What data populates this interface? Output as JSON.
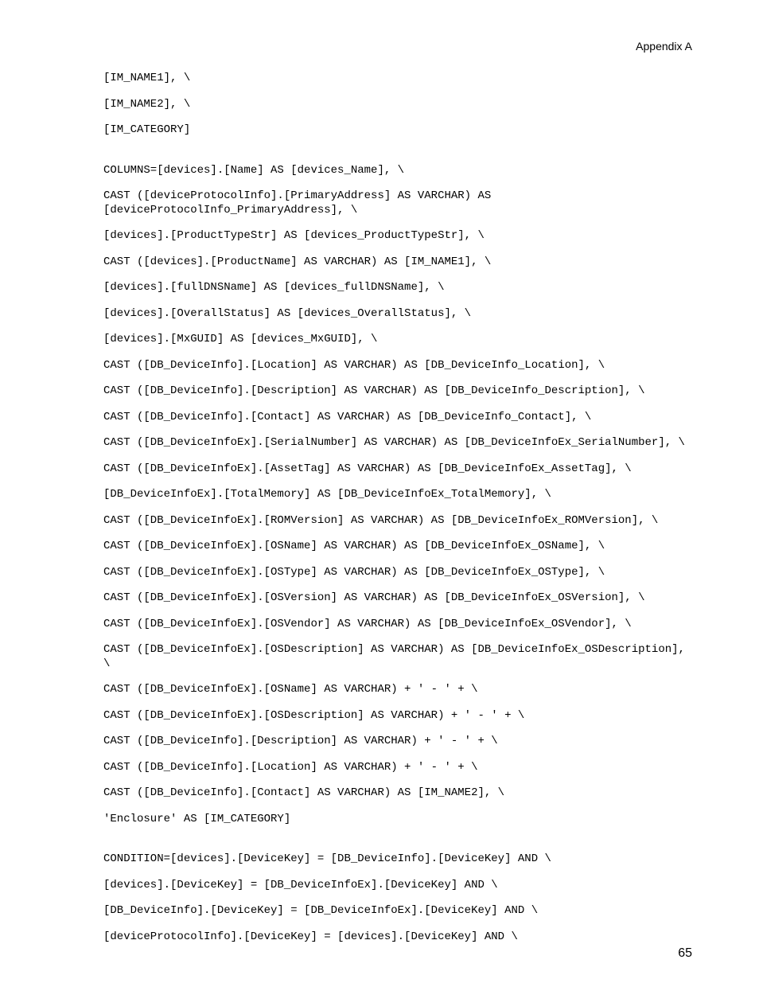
{
  "header": {
    "title": "Appendix A"
  },
  "code": {
    "lines": [
      "[IM_NAME1], \\",
      "[IM_NAME2], \\",
      "[IM_CATEGORY]",
      "",
      "COLUMNS=[devices].[Name] AS [devices_Name], \\",
      "CAST ([deviceProtocolInfo].[PrimaryAddress] AS VARCHAR) AS [deviceProtocolInfo_PrimaryAddress], \\",
      "[devices].[ProductTypeStr] AS [devices_ProductTypeStr], \\",
      "CAST ([devices].[ProductName] AS VARCHAR) AS [IM_NAME1], \\",
      "[devices].[fullDNSName] AS [devices_fullDNSName], \\",
      "[devices].[OverallStatus] AS [devices_OverallStatus], \\",
      "[devices].[MxGUID] AS [devices_MxGUID], \\",
      "CAST ([DB_DeviceInfo].[Location] AS VARCHAR) AS [DB_DeviceInfo_Location], \\",
      "CAST ([DB_DeviceInfo].[Description] AS VARCHAR) AS [DB_DeviceInfo_Description], \\",
      "CAST ([DB_DeviceInfo].[Contact] AS VARCHAR) AS [DB_DeviceInfo_Contact], \\",
      "CAST ([DB_DeviceInfoEx].[SerialNumber] AS VARCHAR) AS [DB_DeviceInfoEx_SerialNumber], \\",
      "CAST ([DB_DeviceInfoEx].[AssetTag] AS VARCHAR) AS [DB_DeviceInfoEx_AssetTag], \\",
      "[DB_DeviceInfoEx].[TotalMemory] AS [DB_DeviceInfoEx_TotalMemory], \\",
      "CAST ([DB_DeviceInfoEx].[ROMVersion] AS VARCHAR) AS [DB_DeviceInfoEx_ROMVersion], \\",
      "CAST ([DB_DeviceInfoEx].[OSName] AS VARCHAR) AS [DB_DeviceInfoEx_OSName], \\",
      "CAST ([DB_DeviceInfoEx].[OSType] AS VARCHAR) AS [DB_DeviceInfoEx_OSType], \\",
      "CAST ([DB_DeviceInfoEx].[OSVersion] AS VARCHAR) AS [DB_DeviceInfoEx_OSVersion], \\",
      "CAST ([DB_DeviceInfoEx].[OSVendor] AS VARCHAR) AS [DB_DeviceInfoEx_OSVendor], \\",
      "CAST ([DB_DeviceInfoEx].[OSDescription] AS VARCHAR) AS [DB_DeviceInfoEx_OSDescription], \\",
      "CAST ([DB_DeviceInfoEx].[OSName] AS VARCHAR) + ' - ' + \\",
      "CAST ([DB_DeviceInfoEx].[OSDescription] AS VARCHAR) + ' - ' + \\",
      "CAST ([DB_DeviceInfo].[Description] AS VARCHAR) + ' - ' + \\",
      "CAST ([DB_DeviceInfo].[Location] AS VARCHAR) + ' - ' + \\",
      "CAST ([DB_DeviceInfo].[Contact] AS VARCHAR) AS [IM_NAME2], \\",
      "'Enclosure' AS [IM_CATEGORY]",
      "",
      "CONDITION=[devices].[DeviceKey] = [DB_DeviceInfo].[DeviceKey] AND \\",
      "[devices].[DeviceKey] = [DB_DeviceInfoEx].[DeviceKey] AND \\",
      "[DB_DeviceInfo].[DeviceKey] = [DB_DeviceInfoEx].[DeviceKey] AND \\",
      "[deviceProtocolInfo].[DeviceKey] = [devices].[DeviceKey] AND \\"
    ]
  },
  "footer": {
    "page_number": "65"
  }
}
